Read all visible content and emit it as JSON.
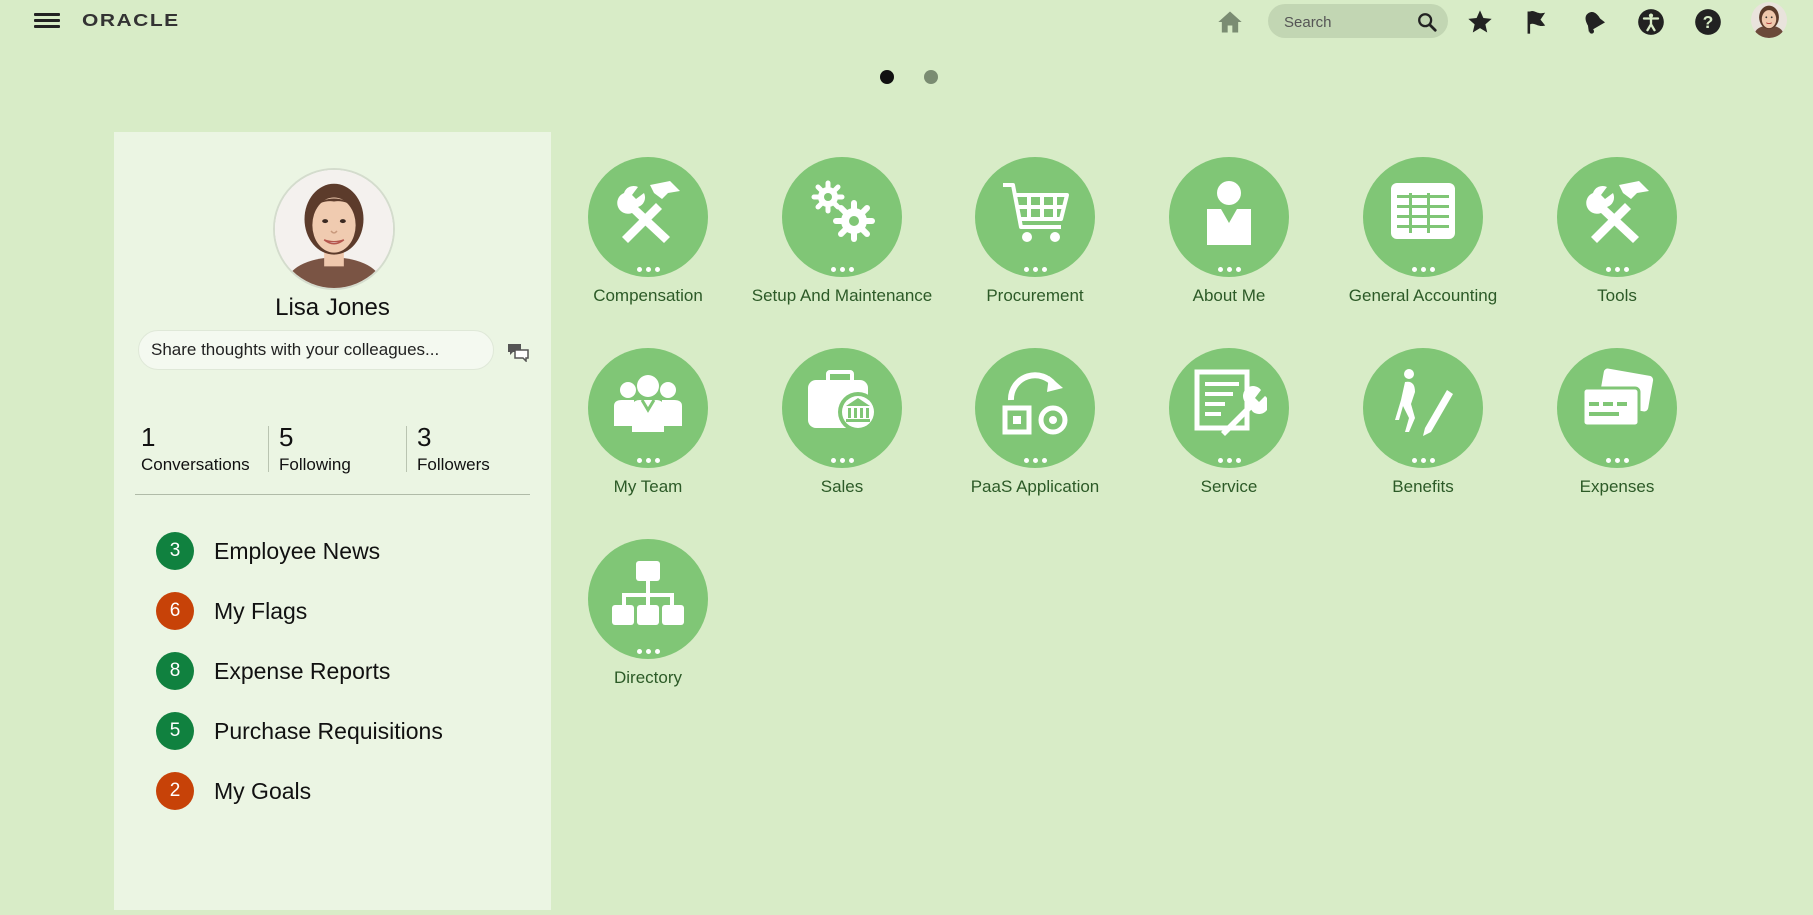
{
  "header": {
    "logo": "ORACLE",
    "search_placeholder": "Search",
    "icons": [
      "home-icon",
      "search-icon",
      "star-icon",
      "flag-icon",
      "bell-icon",
      "accessibility-icon",
      "help-icon"
    ]
  },
  "carousel": {
    "pages": 2,
    "active": 1
  },
  "profile": {
    "name": "Lisa Jones",
    "share_placeholder": "Share thoughts with your colleagues...",
    "stats": [
      {
        "value": "1",
        "label": "Conversations"
      },
      {
        "value": "5",
        "label": "Following"
      },
      {
        "value": "3",
        "label": "Followers"
      }
    ],
    "quick_links": [
      {
        "count": "3",
        "label": "Employee News",
        "color": "#10813f"
      },
      {
        "count": "6",
        "label": "My Flags",
        "color": "#c74208"
      },
      {
        "count": "8",
        "label": "Expense Reports",
        "color": "#10813f"
      },
      {
        "count": "5",
        "label": "Purchase Requisitions",
        "color": "#10813f"
      },
      {
        "count": "2",
        "label": "My Goals",
        "color": "#c74208"
      }
    ]
  },
  "apps": [
    {
      "label": "Compensation",
      "icon": "tools-icon"
    },
    {
      "label": "Setup And Maintenance",
      "icon": "gears-icon"
    },
    {
      "label": "Procurement",
      "icon": "cart-icon"
    },
    {
      "label": "About Me",
      "icon": "person-icon"
    },
    {
      "label": "General Accounting",
      "icon": "ledger-icon"
    },
    {
      "label": "Tools",
      "icon": "tools-icon"
    },
    {
      "label": "My Team",
      "icon": "team-icon"
    },
    {
      "label": "Sales",
      "icon": "briefcase-bank-icon"
    },
    {
      "label": "PaaS Application",
      "icon": "refresh-shapes-icon"
    },
    {
      "label": "Service",
      "icon": "form-wrench-icon"
    },
    {
      "label": "Benefits",
      "icon": "figure-pencil-icon"
    },
    {
      "label": "Expenses",
      "icon": "cards-icon"
    },
    {
      "label": "Directory",
      "icon": "org-chart-icon"
    }
  ],
  "colors": {
    "background": "#d8ecc7",
    "panel": "#ebf5e3",
    "app_circle": "#80c676",
    "app_label": "#2c5a27",
    "badge_green": "#10813f",
    "badge_orange": "#c74208"
  }
}
